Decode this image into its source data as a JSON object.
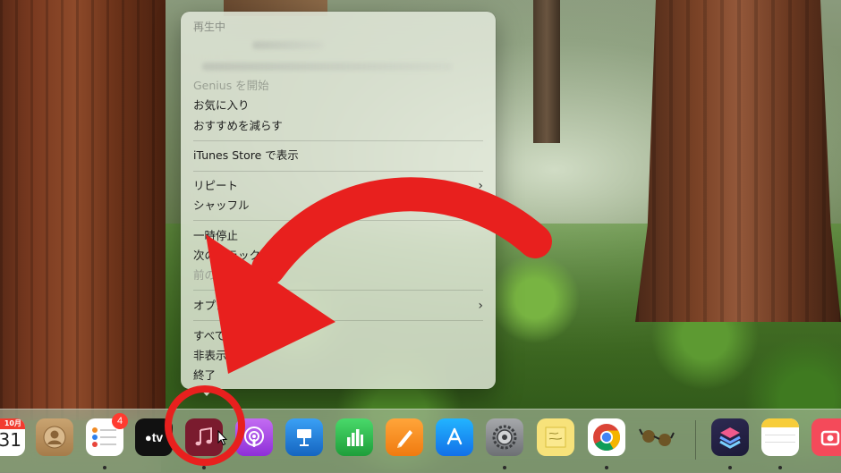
{
  "menu": {
    "header_now_playing": "再生中",
    "genius": "Genius を開始",
    "favorite": "お気に入り",
    "suggest_less": "おすすめを減らす",
    "show_in_store": "iTunes Store で表示",
    "repeat": "リピート",
    "shuffle": "シャッフル",
    "pause": "一時停止",
    "next_track": "次のトラック",
    "prev_track": "前のトラ",
    "options": "オプショ",
    "show_all": "すべての",
    "hide": "非表示",
    "quit": "終了"
  },
  "dock": {
    "calendar_month": "10月",
    "calendar_day": "31",
    "reminders_badge": "4",
    "appletv_label": "tv",
    "apps": [
      {
        "name": "calendar",
        "active": false
      },
      {
        "name": "contacts",
        "active": false
      },
      {
        "name": "reminders",
        "active": true
      },
      {
        "name": "apple-tv",
        "active": false
      },
      {
        "name": "music",
        "active": true
      },
      {
        "name": "podcasts",
        "active": false
      },
      {
        "name": "keynote",
        "active": false
      },
      {
        "name": "numbers",
        "active": false
      },
      {
        "name": "pages",
        "active": false
      },
      {
        "name": "app-store",
        "active": false
      },
      {
        "name": "system-settings",
        "active": true
      },
      {
        "name": "stickies",
        "active": false
      },
      {
        "name": "chrome",
        "active": true
      },
      {
        "name": "glasses",
        "active": false
      },
      {
        "name": "shortcuts",
        "active": true
      },
      {
        "name": "notes",
        "active": true
      },
      {
        "name": "camera-app",
        "active": false
      }
    ]
  },
  "colors": {
    "annotation_red": "#e8201e",
    "music_icon_bg": "#7a1b2e"
  }
}
